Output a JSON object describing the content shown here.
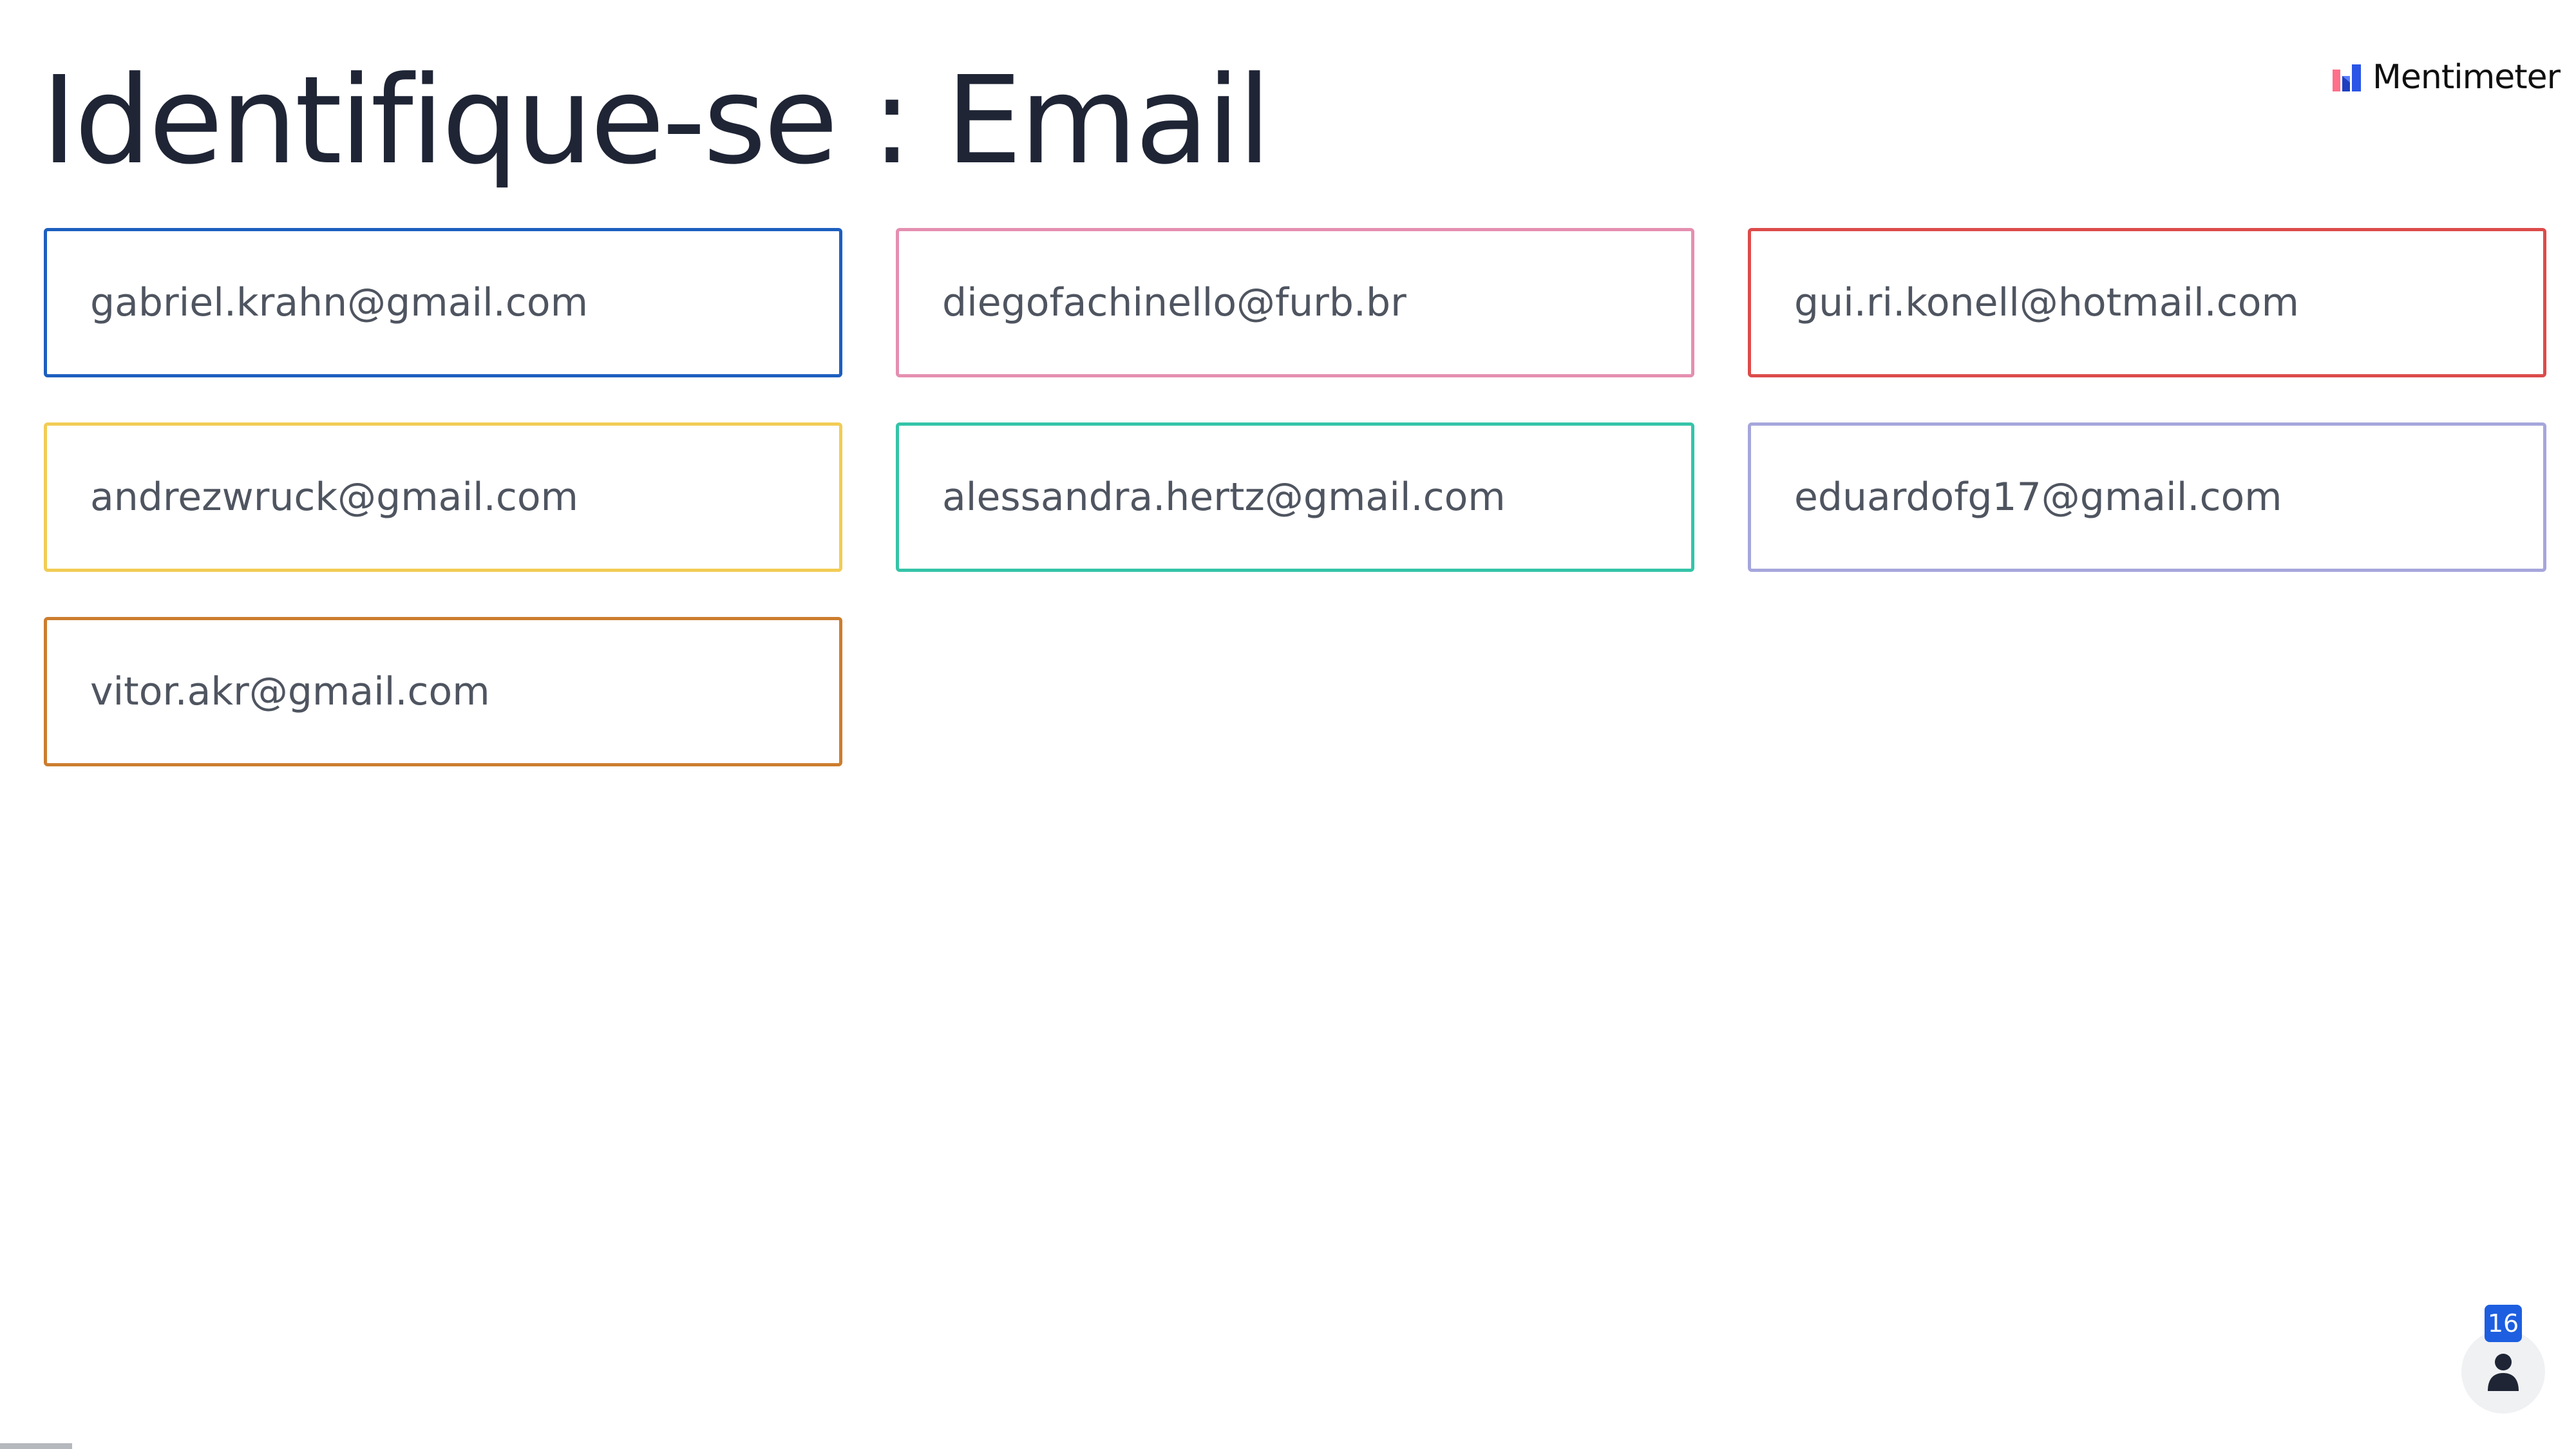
{
  "slide": {
    "title": "Identifique-se : Email"
  },
  "brand": {
    "name": "Mentimeter",
    "logo_icon": "mentimeter-logo-icon"
  },
  "responses": [
    {
      "text": "gabriel.krahn@gmail.com",
      "color": "#1d5fbf"
    },
    {
      "text": "diegofachinello@furb.br",
      "color": "#e58fb0"
    },
    {
      "text": "gui.ri.konell@hotmail.com",
      "color": "#dd4b4b"
    },
    {
      "text": "andrezwruck@gmail.com",
      "color": "#f2cc55"
    },
    {
      "text": "alessandra.hertz@gmail.com",
      "color": "#35c4a8"
    },
    {
      "text": "eduardofg17@gmail.com",
      "color": "#a6a6dc"
    },
    {
      "text": "vitor.akr@gmail.com",
      "color": "#cc7d2e"
    }
  ],
  "participants": {
    "count": "16",
    "icon": "person-icon",
    "badge_color": "#1d5fe0"
  }
}
